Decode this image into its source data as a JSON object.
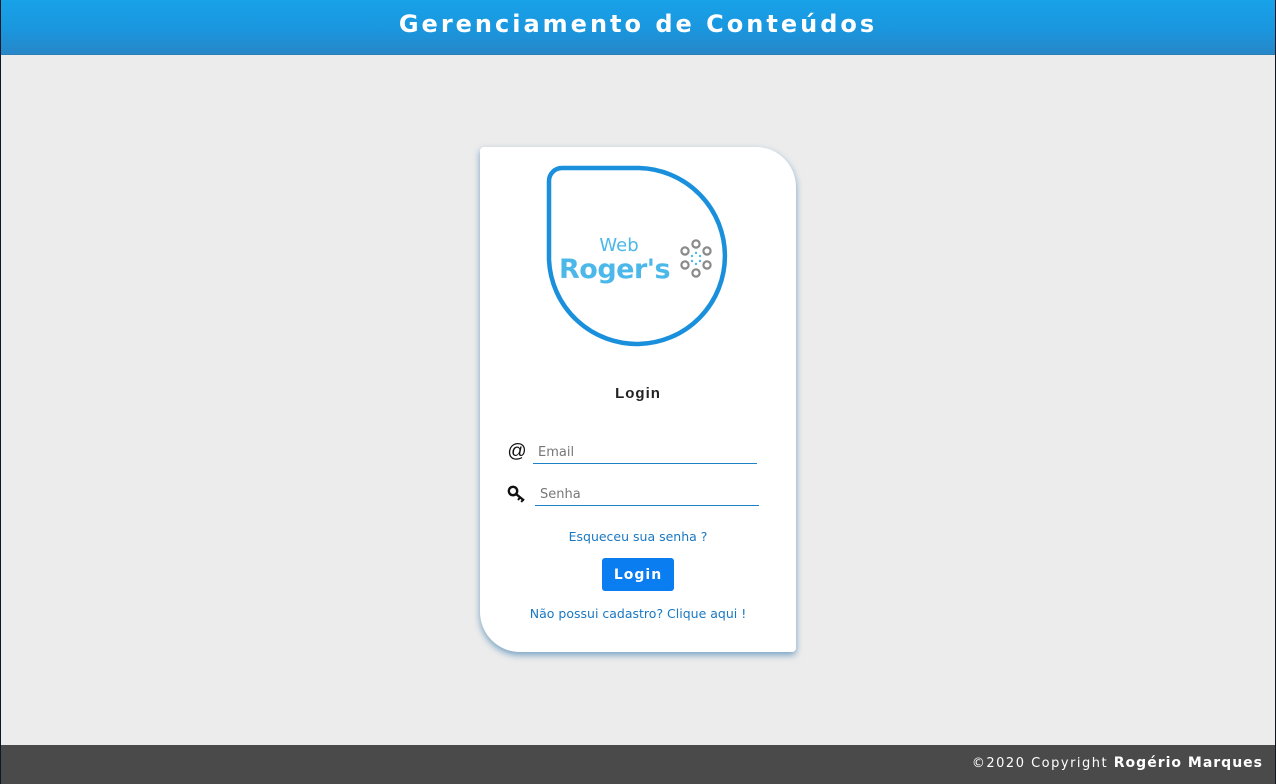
{
  "header": {
    "title": "Gerenciamento de Conteúdos"
  },
  "logo": {
    "line1": "Web",
    "line2": "Roger's",
    "colors": {
      "outline": "#1a90dc",
      "text": "#4cb8ea",
      "dots": "#8a8a8a",
      "center_dots": "#4cb8ea"
    }
  },
  "login": {
    "title": "Login",
    "email": {
      "icon": "at-sign-icon",
      "icon_glyph": "@",
      "placeholder": "Email",
      "value": ""
    },
    "password": {
      "icon": "key-icon",
      "placeholder": "Senha",
      "value": ""
    },
    "forgot_link": "Esqueceu sua senha ?",
    "submit_label": "Login",
    "register_link": "Não possui cadastro? Clique aqui !"
  },
  "footer": {
    "copyright": "©2020 Copyright",
    "author": "Rogério Marques"
  },
  "colors": {
    "header_blue": "#18a2e8",
    "page_background": "#ececec",
    "button_blue": "#0a7df0",
    "link_blue": "#1a78c2",
    "footer_gray": "#4a4a4a"
  }
}
